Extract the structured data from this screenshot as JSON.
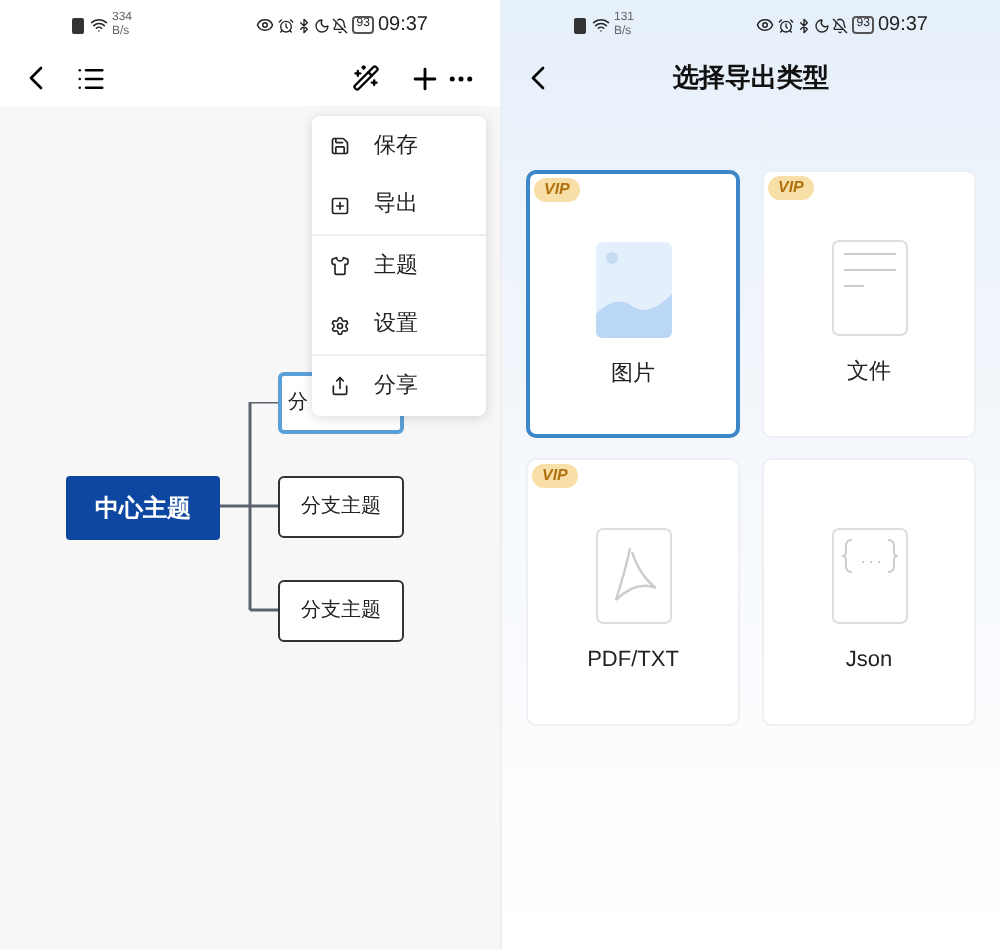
{
  "left_screen": {
    "status_bar": {
      "speed_value": "334",
      "speed_unit": "B/s",
      "battery": "93",
      "time": "09:37"
    },
    "mind_map": {
      "central_topic": "中心主题",
      "branches": [
        {
          "text": "分",
          "selected": true
        },
        {
          "text": "分支主题",
          "selected": false
        },
        {
          "text": "分支主题",
          "selected": false
        }
      ]
    },
    "menu": {
      "items": [
        {
          "label": "保存",
          "kind": "save",
          "divider_after": false
        },
        {
          "label": "导出",
          "kind": "export",
          "divider_after": true
        },
        {
          "label": "主题",
          "kind": "theme",
          "divider_after": false
        },
        {
          "label": "设置",
          "kind": "settings",
          "divider_after": true
        },
        {
          "label": "分享",
          "kind": "share",
          "divider_after": false
        }
      ]
    }
  },
  "right_screen": {
    "status_bar": {
      "speed_value": "131",
      "speed_unit": "B/s",
      "battery": "93",
      "time": "09:37"
    },
    "title": "选择导出类型",
    "options": [
      {
        "label": "图片",
        "kind": "image",
        "vip": "VIP",
        "selected": true
      },
      {
        "label": "文件",
        "kind": "document",
        "vip": "VIP",
        "selected": false
      },
      {
        "label": "PDF/TXT",
        "kind": "pdf",
        "vip": "VIP",
        "selected": false
      },
      {
        "label": "Json",
        "kind": "json",
        "selected": false
      }
    ]
  }
}
